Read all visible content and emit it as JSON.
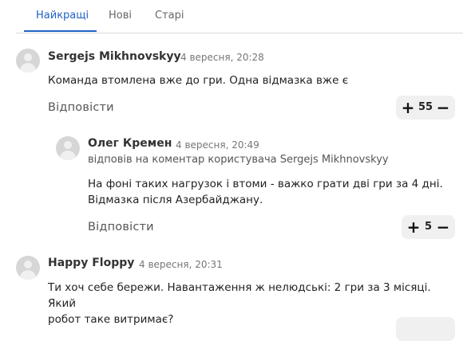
{
  "tabs": [
    {
      "label": "Найкращі",
      "active": true
    },
    {
      "label": "Нові",
      "active": false
    },
    {
      "label": "Старі",
      "active": false
    }
  ],
  "colors": {
    "accent": "#1f62c5",
    "divider": "#d9d9d9",
    "vote_bg": "#f0f0f0"
  },
  "comments": [
    {
      "author": "Sergejs Mikhnovskyy",
      "time": "4 вересня, 20:28",
      "text": "Команда втомлена вже до гри. Одна відмазка вже є",
      "reply_label": "Відповісти",
      "votes": "55"
    },
    {
      "author": "Олег Кремен",
      "time": "4 вересня, 20:49",
      "reply_to": "відповів на коментар користувача Sergejs Mikhnovskyy",
      "text_line1": "На фоні таких нагрузок і втоми - важко грати дві гри за 4 дні.",
      "text_line2": "Відмазка після Азербайджану.",
      "reply_label": "Відповісти",
      "votes": "5"
    },
    {
      "author": "Happy Floppy",
      "time": "4 вересня, 20:31",
      "text_line1": "Ти хоч себе бережи. Навантаження ж нелюдські: 2 гри за 3 місяці. Який",
      "text_line2": "робот таке витримає?"
    }
  ]
}
